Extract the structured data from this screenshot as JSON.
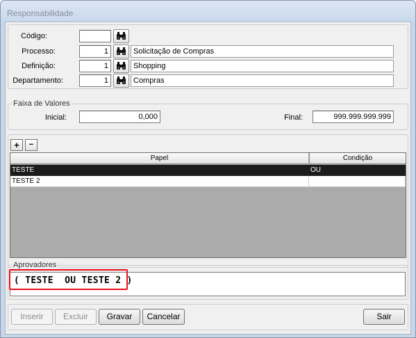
{
  "window": {
    "title": "Responsabilidade"
  },
  "filters": {
    "codigo": {
      "label": "Código:",
      "value": ""
    },
    "processo": {
      "label": "Processo:",
      "value": "1",
      "description": "Solicitação de Compras"
    },
    "definicao": {
      "label": "Definição:",
      "value": "1",
      "description": "Shopping"
    },
    "departamento": {
      "label": "Departamento:",
      "value": "1",
      "description": "Compras"
    }
  },
  "faixa": {
    "legend": "Faixa de Valores",
    "inicial_label": "Inicial:",
    "inicial_value": "0,000",
    "final_label": "Final:",
    "final_value": "999.999.999.999"
  },
  "grid": {
    "add_label": "+",
    "remove_label": "−",
    "columns": [
      "Papel",
      "Condição"
    ],
    "rows": [
      {
        "papel": "TESTE",
        "condicao": "OU",
        "selected": true
      },
      {
        "papel": "TESTE 2",
        "condicao": "",
        "selected": false
      }
    ]
  },
  "aprovadores": {
    "legend": "Aprovadores",
    "expression": "( TESTE  OU TESTE 2 )",
    "highlight_color": "#e8101a"
  },
  "buttons": {
    "inserir": "Inserir",
    "excluir": "Excluir",
    "gravar": "Gravar",
    "cancelar": "Cancelar",
    "sair": "Sair"
  },
  "colors": {
    "selection": "#1c1c1c",
    "grid_background": "#ababab"
  }
}
